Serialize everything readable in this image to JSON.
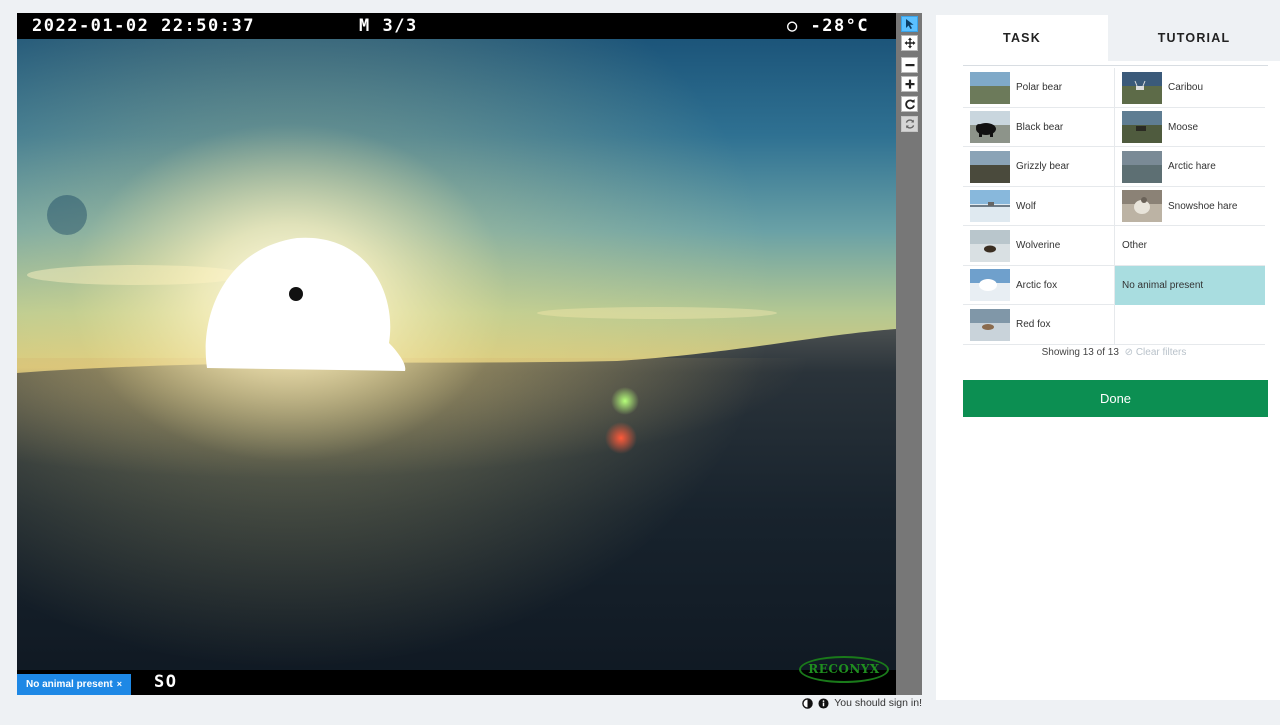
{
  "camera": {
    "timestamp": "2022-01-02 22:50:37",
    "mode": "M 3/3",
    "moon_phase_icon": "moon-empty-icon",
    "temperature": "○  -28°C",
    "station_partial": "SO",
    "brand": "RECONYX"
  },
  "annotation": {
    "label": "No animal present",
    "remove_icon": "close-icon",
    "remove_glyph": "×"
  },
  "toolbar": {
    "tools": [
      {
        "name": "pointer-icon",
        "active": true
      },
      {
        "name": "pan-icon",
        "active": false
      },
      {
        "name": "zoom-out-icon",
        "active": false
      },
      {
        "name": "zoom-in-icon",
        "active": false
      },
      {
        "name": "rotate-icon",
        "active": false
      },
      {
        "name": "reset-icon",
        "active": false,
        "disabled": true
      }
    ]
  },
  "footer": {
    "contrast_icon": "contrast-icon",
    "info_icon": "info-icon",
    "sign_in_text": "You should sign in!"
  },
  "tabs": {
    "task": "TASK",
    "tutorial": "TUTORIAL",
    "active": "task"
  },
  "choices": [
    {
      "label": "Polar bear",
      "thumb": "polar-bear-thumb",
      "selected": false
    },
    {
      "label": "Caribou",
      "thumb": "caribou-thumb",
      "selected": false
    },
    {
      "label": "Black bear",
      "thumb": "black-bear-thumb",
      "selected": false
    },
    {
      "label": "Moose",
      "thumb": "moose-thumb",
      "selected": false
    },
    {
      "label": "Grizzly bear",
      "thumb": "grizzly-bear-thumb",
      "selected": false
    },
    {
      "label": "Arctic hare",
      "thumb": "arctic-hare-thumb",
      "selected": false
    },
    {
      "label": "Wolf",
      "thumb": "wolf-thumb",
      "selected": false
    },
    {
      "label": "Snowshoe hare",
      "thumb": "snowshoe-hare-thumb",
      "selected": false
    },
    {
      "label": "Wolverine",
      "thumb": "wolverine-thumb",
      "selected": false
    },
    {
      "label": "Other",
      "thumb": null,
      "selected": false
    },
    {
      "label": "Arctic fox",
      "thumb": "arctic-fox-thumb",
      "selected": false
    },
    {
      "label": "No animal present",
      "thumb": null,
      "selected": true
    },
    {
      "label": "Red fox",
      "thumb": "red-fox-thumb",
      "selected": false
    }
  ],
  "filter": {
    "showing": "Showing 13 of 13",
    "clear_icon": "clear-filter-icon",
    "clear_label": "⊘ Clear filters"
  },
  "done_label": "Done",
  "colors": {
    "selected_choice": "#a9dde0",
    "done_button": "#0c8f52",
    "annotation_chip": "#1e88e5",
    "active_tool": "#5bc0ff"
  }
}
